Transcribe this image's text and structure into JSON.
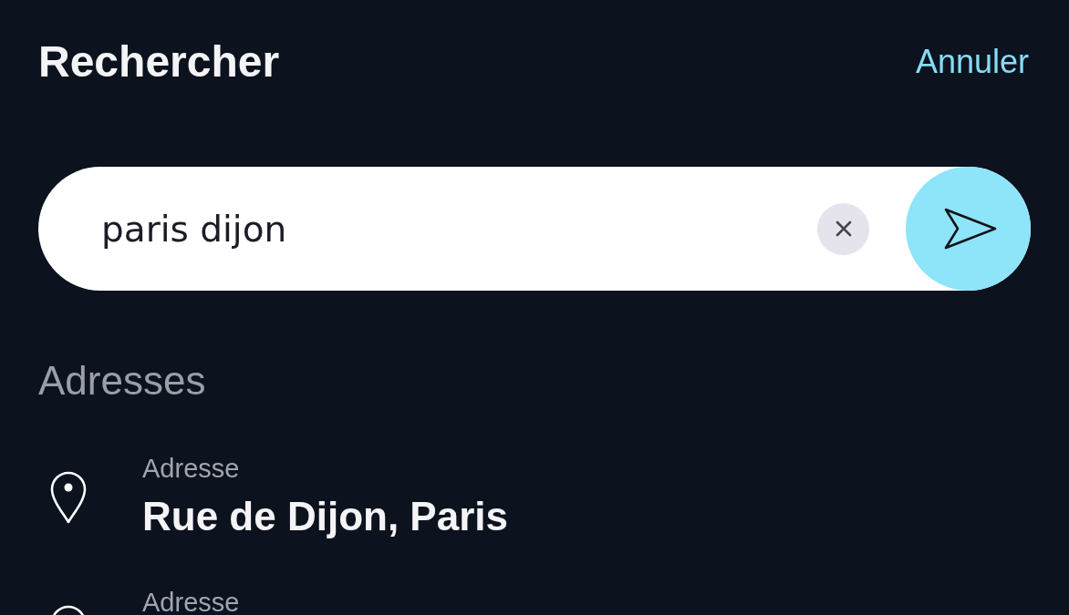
{
  "header": {
    "title": "Rechercher",
    "cancel": "Annuler"
  },
  "search": {
    "value": "paris dijon"
  },
  "section": {
    "title": "Adresses"
  },
  "results": [
    {
      "label": "Adresse",
      "title": "Rue de Dijon, Paris"
    },
    {
      "label": "Adresse"
    }
  ]
}
